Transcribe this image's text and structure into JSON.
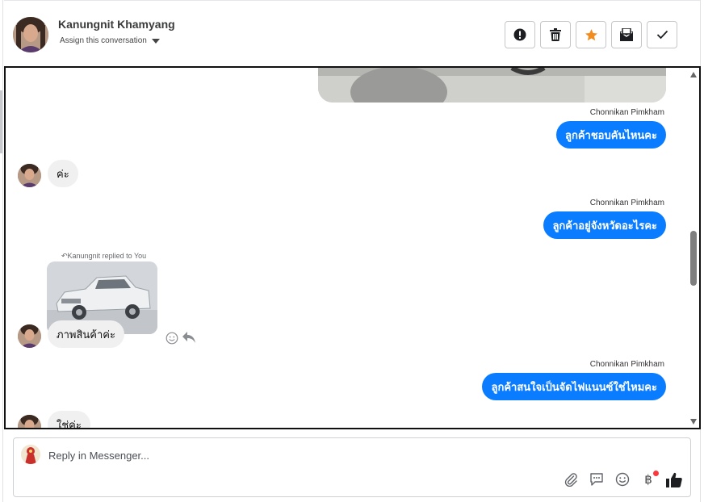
{
  "header": {
    "contact_name": "Kanungnit Khamyang",
    "assign_label": "Assign this conversation",
    "actions": [
      "spam-report",
      "delete",
      "star",
      "mark-unread",
      "mark-done"
    ]
  },
  "colors": {
    "accent_blue": "#0a7cff",
    "star_orange": "#f28c1e",
    "incoming_bubble": "#f0f0f0",
    "notification_dot": "#fa383e"
  },
  "conversation": {
    "messages": [
      {
        "direction": "out",
        "sender": "Chonnikan Pimkham",
        "text": "ลูกค้าชอบคันไหนคะ"
      },
      {
        "direction": "in",
        "text": "ค่ะ"
      },
      {
        "direction": "out",
        "sender": "Chonnikan Pimkham",
        "text": "ลูกค้าอยู่จังหวัดอะไรคะ"
      },
      {
        "direction": "in",
        "reply_note": "Kanungnit replied to You",
        "text": "ภาพสินค้าค่ะ"
      },
      {
        "direction": "out",
        "sender": "Chonnikan Pimkham",
        "text": "ลูกค้าสนใจเป็นจัดไฟแนนซ์ใช่ไหมคะ"
      },
      {
        "direction": "in",
        "text": "ใช่ค่ะ"
      }
    ]
  },
  "composer": {
    "placeholder": "Reply in Messenger...",
    "tools": [
      "attachment-icon",
      "saved-reply-icon",
      "emoji-icon",
      "payment-icon",
      "like-icon"
    ],
    "payment_symbol": "฿"
  }
}
